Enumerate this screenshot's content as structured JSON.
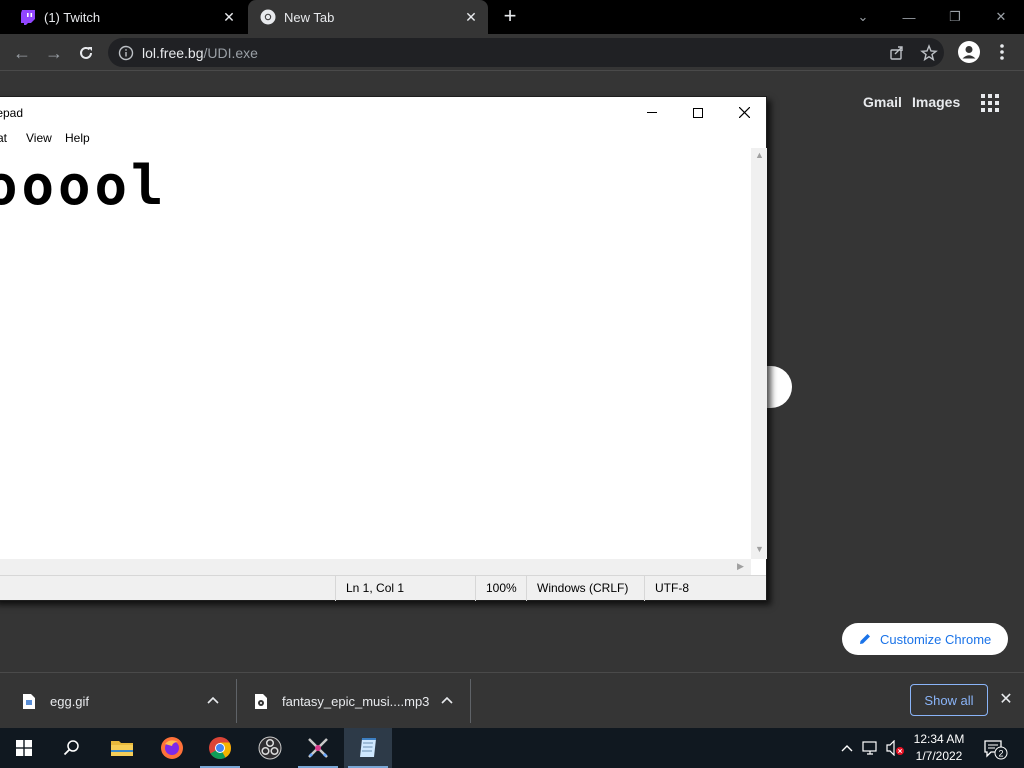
{
  "browser": {
    "tabs": [
      {
        "title": "(1) Twitch",
        "icon": "twitch-icon"
      },
      {
        "title": "New Tab",
        "icon": "chrome-icon"
      }
    ],
    "url": {
      "host": "lol.free.bg",
      "path": "/UDI.exe"
    }
  },
  "ntp": {
    "gmail": "Gmail",
    "images": "Images",
    "customize": "Customize Chrome"
  },
  "notepad": {
    "title": "tepad",
    "menu": [
      "at",
      "View",
      "Help"
    ],
    "content": "ooool",
    "status": {
      "position": "Ln 1, Col 1",
      "zoom": "100%",
      "line_ending": "Windows (CRLF)",
      "encoding": "UTF-8"
    }
  },
  "downloads": {
    "items": [
      {
        "name": "egg.gif"
      },
      {
        "name": "fantasy_epic_musi....mp3"
      }
    ],
    "show_all": "Show all"
  },
  "taskbar": {
    "time": "12:34 AM",
    "date": "1/7/2022",
    "notifications": "2"
  },
  "colors": {
    "chrome_dark": "#353535",
    "tab_strip": "#000000",
    "accent_blue": "#8ab4f8",
    "taskbar": "#101820"
  }
}
